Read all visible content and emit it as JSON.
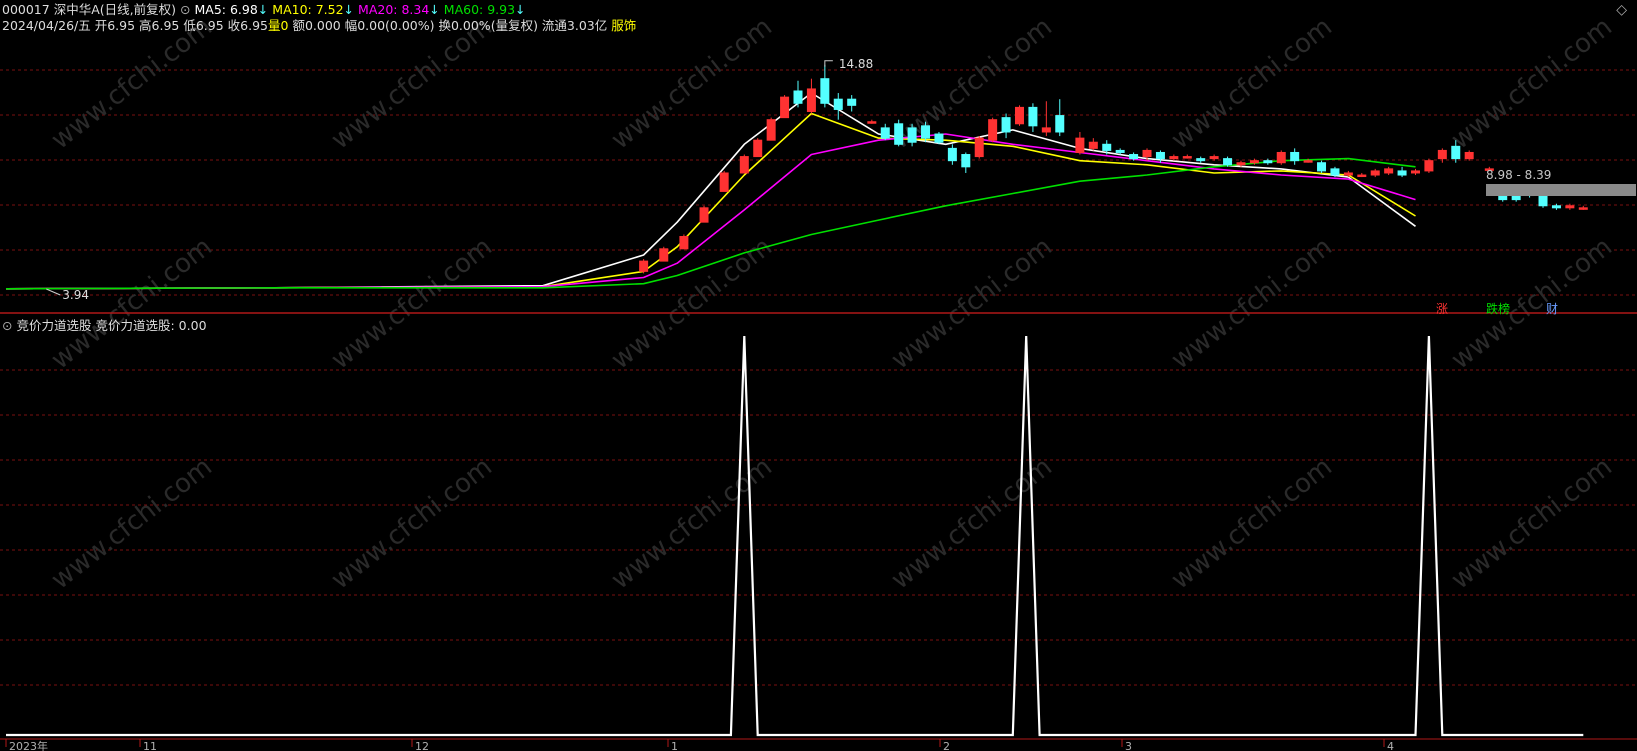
{
  "header": {
    "code": "000017",
    "name": "深中华A(日线,前复权)",
    "ma5_label": "MA5: 6.98",
    "ma10_label": "MA10: 7.52",
    "ma20_label": "MA20: 8.34",
    "ma60_label": "MA60: 9.93",
    "arrow": "↓",
    "info": "2024/04/26/五 开6.95 高6.95 低6.95 收6.95",
    "vol_label": "量",
    "vol_value": "0",
    "info2": "额0.000 幅0.00(0.00%) 换0.00%(量复权) 流通3.03亿",
    "sector": "服饰"
  },
  "colors": {
    "ma5": "#ffffff",
    "ma10": "#ffff00",
    "ma20": "#ff00ff",
    "ma60": "#00e000",
    "up": "#ff3232",
    "down": "#54ffff",
    "grid": "#7a1010",
    "bg": "#000000"
  },
  "annotations": {
    "high": "14.88",
    "low": "3.94",
    "range": "8.98 - 8.39"
  },
  "markers": {
    "zhang": "涨",
    "diebang": "跌榜",
    "cai": "财"
  },
  "indicator": {
    "title": "竞价力道选股",
    "label": "竞价力道选股: 0.00"
  },
  "watermark": "www.cfchi.com",
  "x_axis_labels": [
    "2023年",
    "11",
    "12",
    "1",
    "2",
    "3",
    "4"
  ],
  "chart_data": [
    {
      "type": "candlestick",
      "title": "000017 深中华A(日线,前复权)",
      "ylim": [
        3.5,
        15.6
      ],
      "series": [
        {
          "name": "MA5",
          "x": [
            0,
            40,
            80,
            95,
            100,
            110,
            120,
            130,
            140,
            150,
            160,
            170,
            180,
            190,
            200,
            210
          ],
          "values": [
            3.95,
            4.0,
            4.1,
            5.6,
            7.2,
            11.0,
            13.5,
            11.5,
            11.0,
            11.7,
            10.8,
            10.3,
            10.0,
            9.8,
            9.4,
            7.0
          ]
        },
        {
          "name": "MA10",
          "x": [
            0,
            40,
            80,
            95,
            100,
            110,
            120,
            130,
            140,
            150,
            160,
            170,
            180,
            190,
            200,
            210
          ],
          "values": [
            3.95,
            4.0,
            4.05,
            4.8,
            6.0,
            9.5,
            12.5,
            11.3,
            11.2,
            10.9,
            10.2,
            10.0,
            9.6,
            9.7,
            9.5,
            7.5
          ]
        },
        {
          "name": "MA20",
          "x": [
            0,
            40,
            80,
            95,
            100,
            110,
            120,
            130,
            140,
            150,
            160,
            170,
            180,
            190,
            200,
            210
          ],
          "values": [
            3.95,
            4.0,
            4.05,
            4.5,
            5.2,
            7.8,
            10.5,
            11.2,
            11.5,
            11.0,
            10.6,
            10.2,
            9.8,
            9.5,
            9.3,
            8.3
          ]
        },
        {
          "name": "MA60",
          "x": [
            0,
            40,
            80,
            95,
            100,
            110,
            120,
            130,
            140,
            150,
            160,
            170,
            180,
            190,
            200,
            210
          ],
          "values": [
            3.95,
            4.0,
            4.0,
            4.2,
            4.6,
            5.7,
            6.6,
            7.3,
            8.0,
            8.6,
            9.2,
            9.5,
            9.9,
            10.2,
            10.3,
            9.9
          ]
        }
      ],
      "candles": [
        {
          "i": 95,
          "o": 4.8,
          "c": 5.3,
          "h": 5.4,
          "l": 4.7
        },
        {
          "i": 98,
          "o": 5.3,
          "c": 5.9,
          "h": 6.0,
          "l": 5.3
        },
        {
          "i": 101,
          "o": 5.9,
          "c": 6.5,
          "h": 6.6,
          "l": 5.9
        },
        {
          "i": 104,
          "o": 7.2,
          "c": 7.9,
          "h": 8.0,
          "l": 7.2
        },
        {
          "i": 107,
          "o": 8.7,
          "c": 9.6,
          "h": 9.7,
          "l": 8.7
        },
        {
          "i": 110,
          "o": 9.6,
          "c": 10.4,
          "h": 10.5,
          "l": 9.6
        },
        {
          "i": 112,
          "o": 10.4,
          "c": 11.2,
          "h": 11.3,
          "l": 10.4
        },
        {
          "i": 114,
          "o": 11.2,
          "c": 12.2,
          "h": 12.3,
          "l": 11.2
        },
        {
          "i": 116,
          "o": 12.3,
          "c": 13.3,
          "h": 13.4,
          "l": 12.3
        },
        {
          "i": 118,
          "o": 13.6,
          "c": 13.0,
          "h": 14.1,
          "l": 12.8
        },
        {
          "i": 120,
          "o": 12.6,
          "c": 13.7,
          "h": 14.2,
          "l": 12.5
        },
        {
          "i": 122,
          "o": 14.2,
          "c": 13.0,
          "h": 14.88,
          "l": 12.8
        },
        {
          "i": 124,
          "o": 13.2,
          "c": 12.7,
          "h": 13.5,
          "l": 12.2
        },
        {
          "i": 126,
          "o": 13.2,
          "c": 12.9,
          "h": 13.4,
          "l": 12.6
        },
        {
          "i": 129,
          "o": 12.1,
          "c": 12.1,
          "h": 12.2,
          "l": 12.0
        },
        {
          "i": 131,
          "o": 11.8,
          "c": 11.3,
          "h": 12.0,
          "l": 11.2
        },
        {
          "i": 133,
          "o": 12.0,
          "c": 11.0,
          "h": 12.2,
          "l": 10.9
        },
        {
          "i": 135,
          "o": 11.8,
          "c": 11.1,
          "h": 12.0,
          "l": 10.9
        },
        {
          "i": 137,
          "o": 11.9,
          "c": 11.3,
          "h": 12.1,
          "l": 11.1
        },
        {
          "i": 139,
          "o": 11.5,
          "c": 11.1,
          "h": 11.6,
          "l": 11.0
        },
        {
          "i": 141,
          "o": 10.8,
          "c": 10.2,
          "h": 11.0,
          "l": 10.0
        },
        {
          "i": 143,
          "o": 10.5,
          "c": 9.9,
          "h": 10.6,
          "l": 9.6
        },
        {
          "i": 145,
          "o": 10.4,
          "c": 11.3,
          "h": 11.4,
          "l": 10.3
        },
        {
          "i": 147,
          "o": 11.2,
          "c": 12.2,
          "h": 12.3,
          "l": 11.1
        },
        {
          "i": 149,
          "o": 12.3,
          "c": 11.6,
          "h": 12.5,
          "l": 11.3
        },
        {
          "i": 151,
          "o": 12.0,
          "c": 12.8,
          "h": 12.9,
          "l": 11.9
        },
        {
          "i": 153,
          "o": 12.8,
          "c": 11.9,
          "h": 13.0,
          "l": 11.6
        },
        {
          "i": 155,
          "o": 11.6,
          "c": 11.8,
          "h": 13.1,
          "l": 11.4
        },
        {
          "i": 157,
          "o": 12.4,
          "c": 11.6,
          "h": 13.2,
          "l": 11.4
        },
        {
          "i": 160,
          "o": 10.6,
          "c": 11.3,
          "h": 11.6,
          "l": 10.5
        },
        {
          "i": 162,
          "o": 10.8,
          "c": 11.1,
          "h": 11.3,
          "l": 10.7
        },
        {
          "i": 164,
          "o": 11.0,
          "c": 10.7,
          "h": 11.2,
          "l": 10.5
        },
        {
          "i": 166,
          "o": 10.7,
          "c": 10.6,
          "h": 10.8,
          "l": 10.5
        },
        {
          "i": 168,
          "o": 10.5,
          "c": 10.3,
          "h": 10.6,
          "l": 10.2
        },
        {
          "i": 170,
          "o": 10.4,
          "c": 10.7,
          "h": 10.8,
          "l": 10.2
        },
        {
          "i": 172,
          "o": 10.6,
          "c": 10.3,
          "h": 10.7,
          "l": 10.1
        },
        {
          "i": 174,
          "o": 10.3,
          "c": 10.4,
          "h": 10.5,
          "l": 10.2
        },
        {
          "i": 176,
          "o": 10.4,
          "c": 10.4,
          "h": 10.5,
          "l": 10.3
        },
        {
          "i": 178,
          "o": 10.3,
          "c": 10.2,
          "h": 10.4,
          "l": 10.1
        },
        {
          "i": 180,
          "o": 10.3,
          "c": 10.4,
          "h": 10.5,
          "l": 10.2
        },
        {
          "i": 182,
          "o": 10.3,
          "c": 10.0,
          "h": 10.4,
          "l": 9.9
        },
        {
          "i": 184,
          "o": 10.0,
          "c": 10.1,
          "h": 10.2,
          "l": 9.9
        },
        {
          "i": 186,
          "o": 10.1,
          "c": 10.2,
          "h": 10.3,
          "l": 10.0
        },
        {
          "i": 188,
          "o": 10.2,
          "c": 10.1,
          "h": 10.3,
          "l": 10.0
        },
        {
          "i": 190,
          "o": 10.1,
          "c": 10.6,
          "h": 10.7,
          "l": 10.0
        },
        {
          "i": 192,
          "o": 10.6,
          "c": 10.2,
          "h": 10.8,
          "l": 10.0
        },
        {
          "i": 194,
          "o": 10.2,
          "c": 10.2,
          "h": 10.3,
          "l": 10.1
        },
        {
          "i": 196,
          "o": 10.1,
          "c": 9.7,
          "h": 10.2,
          "l": 9.6
        },
        {
          "i": 198,
          "o": 9.8,
          "c": 9.5,
          "h": 9.9,
          "l": 9.4
        },
        {
          "i": 200,
          "o": 9.5,
          "c": 9.6,
          "h": 9.7,
          "l": 9.4
        },
        {
          "i": 202,
          "o": 9.5,
          "c": 9.5,
          "h": 9.6,
          "l": 9.4
        },
        {
          "i": 204,
          "o": 9.5,
          "c": 9.7,
          "h": 9.8,
          "l": 9.4
        },
        {
          "i": 206,
          "o": 9.6,
          "c": 9.8,
          "h": 9.9,
          "l": 9.5
        },
        {
          "i": 208,
          "o": 9.7,
          "c": 9.5,
          "h": 9.9,
          "l": 9.4
        },
        {
          "i": 210,
          "o": 9.6,
          "c": 9.7,
          "h": 9.8,
          "l": 9.5
        },
        {
          "i": 212,
          "o": 9.7,
          "c": 10.2,
          "h": 10.3,
          "l": 9.6
        },
        {
          "i": 214,
          "o": 10.3,
          "c": 10.7,
          "h": 10.8,
          "l": 10.1
        },
        {
          "i": 216,
          "o": 10.9,
          "c": 10.3,
          "h": 11.2,
          "l": 10.1
        },
        {
          "i": 218,
          "o": 10.3,
          "c": 10.6,
          "h": 10.7,
          "l": 10.2
        },
        {
          "i": 221,
          "o": 9.8,
          "c": 9.8,
          "h": 9.9,
          "l": 9.7
        },
        {
          "i": 223,
          "o": 8.8,
          "c": 8.3,
          "h": 9.0,
          "l": 8.2
        },
        {
          "i": 225,
          "o": 8.6,
          "c": 8.3,
          "h": 8.7,
          "l": 8.2
        },
        {
          "i": 227,
          "o": 8.6,
          "c": 8.5,
          "h": 8.8,
          "l": 8.4
        },
        {
          "i": 229,
          "o": 8.5,
          "c": 8.0,
          "h": 8.6,
          "l": 7.9
        },
        {
          "i": 231,
          "o": 8.0,
          "c": 7.9,
          "h": 8.1,
          "l": 7.8
        },
        {
          "i": 233,
          "o": 7.9,
          "c": 8.0,
          "h": 8.1,
          "l": 7.8
        },
        {
          "i": 235,
          "o": 7.9,
          "c": 7.9,
          "h": 8.0,
          "l": 7.8
        }
      ]
    },
    {
      "type": "line",
      "title": "竞价力道选股",
      "ylim": [
        0,
        1
      ],
      "series": [
        {
          "name": "竞价力道选股",
          "x": [
            0,
            108,
            110,
            112,
            150,
            152,
            154,
            210,
            212,
            214,
            235
          ],
          "values": [
            0,
            0,
            1,
            0,
            0,
            1,
            0,
            0,
            1,
            0,
            0
          ]
        }
      ]
    }
  ]
}
